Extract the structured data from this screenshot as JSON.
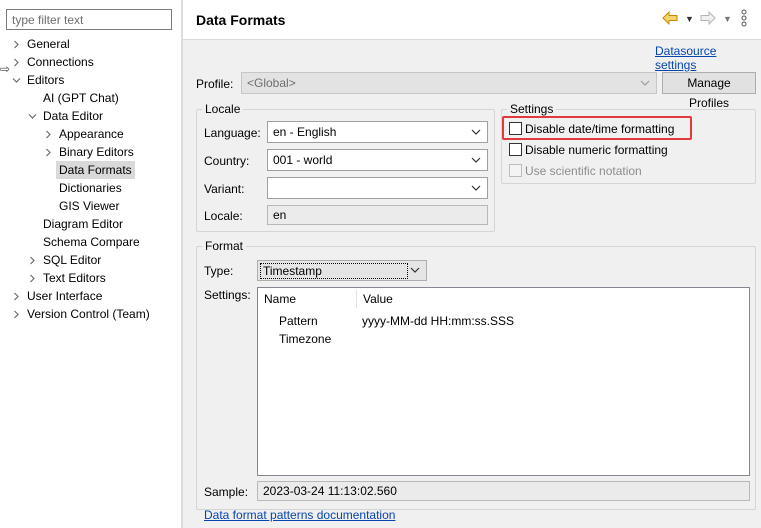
{
  "filter": {
    "placeholder": "type filter text"
  },
  "tree": [
    {
      "label": "General",
      "twisty": "collapsed"
    },
    {
      "label": "Connections",
      "twisty": "collapsed"
    },
    {
      "label": "Editors",
      "twisty": "expanded"
    },
    {
      "label": "AI (GPT Chat)",
      "twisty": "none"
    },
    {
      "label": "Data Editor",
      "twisty": "expanded"
    },
    {
      "label": "Appearance",
      "twisty": "collapsed"
    },
    {
      "label": "Binary Editors",
      "twisty": "collapsed"
    },
    {
      "label": "Data Formats",
      "twisty": "none",
      "selected": true
    },
    {
      "label": "Dictionaries",
      "twisty": "none"
    },
    {
      "label": "GIS Viewer",
      "twisty": "none"
    },
    {
      "label": "Diagram Editor",
      "twisty": "none"
    },
    {
      "label": "Schema Compare",
      "twisty": "none"
    },
    {
      "label": "SQL Editor",
      "twisty": "collapsed"
    },
    {
      "label": "Text Editors",
      "twisty": "collapsed"
    },
    {
      "label": "User Interface",
      "twisty": "collapsed"
    },
    {
      "label": "Version Control (Team)",
      "twisty": "collapsed"
    }
  ],
  "header": {
    "title": "Data Formats",
    "back_icon": "back-arrow-icon",
    "forward_icon": "forward-arrow-icon",
    "menu_icon": "view-menu-icon"
  },
  "datasource_link": "Datasource settings",
  "profile": {
    "label": "Profile:",
    "value": "<Global>",
    "manage_button": "Manage Profiles"
  },
  "locale": {
    "title": "Locale",
    "language_label": "Language:",
    "language_value": "en - English",
    "country_label": "Country:",
    "country_value": "001 - world",
    "variant_label": "Variant:",
    "variant_value": "",
    "locale_label": "Locale:",
    "locale_value": "en"
  },
  "settings": {
    "title": "Settings",
    "disable_datetime": "Disable date/time formatting",
    "disable_numeric": "Disable numeric formatting",
    "scientific": "Use scientific notation",
    "highlight_color": "#e0393e"
  },
  "format": {
    "title": "Format",
    "type_label": "Type:",
    "type_value": "Timestamp",
    "settings_label": "Settings:",
    "columns": [
      "Name",
      "Value"
    ],
    "rows": [
      {
        "name": "Pattern",
        "value": "yyyy-MM-dd HH:mm:ss.SSS"
      },
      {
        "name": "Timezone",
        "value": ""
      }
    ],
    "sample_label": "Sample:",
    "sample_value": "2023-03-24 11:13:02.560",
    "doc_link": "Data format patterns documentation"
  }
}
